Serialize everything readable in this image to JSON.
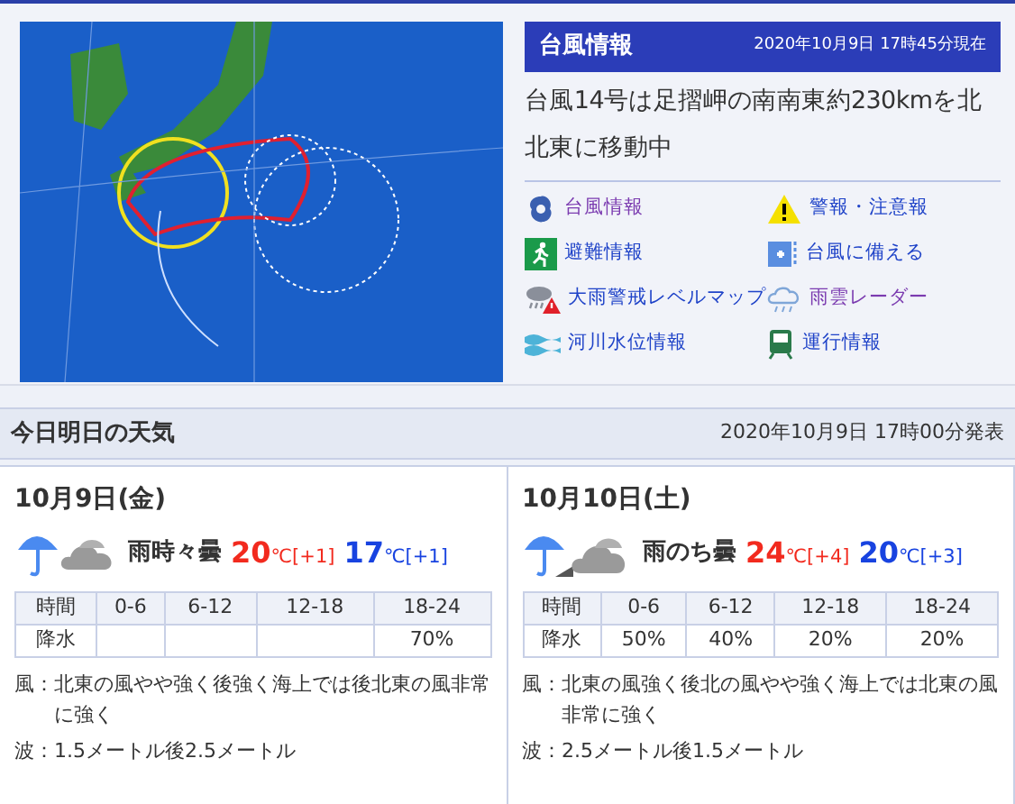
{
  "typhoon": {
    "title": "台風情報",
    "timestamp": "2020年10月9日 17時45分現在",
    "summary": "台風14号は足摺岬の南南東約230kmを北北東に移動中",
    "links": [
      {
        "kind": "typhoon",
        "label": "台風情報",
        "visited": true
      },
      {
        "kind": "warning",
        "label": "警報・注意報",
        "visited": false
      },
      {
        "kind": "evacuation",
        "label": "避難情報",
        "visited": false
      },
      {
        "kind": "prepare",
        "label": "台風に備える",
        "visited": false
      },
      {
        "kind": "heavy-rain",
        "label": "大雨警戒レベルマップ",
        "visited": false
      },
      {
        "kind": "radar",
        "label": "雨雲レーダー",
        "visited": true
      },
      {
        "kind": "river",
        "label": "河川水位情報",
        "visited": false
      },
      {
        "kind": "train",
        "label": "運行情報",
        "visited": false
      }
    ]
  },
  "forecast": {
    "title": "今日明日の天気",
    "issued": "2020年10月9日 17時00分発表",
    "days": [
      {
        "date": "10月9日(金)",
        "kind": "rain-sometimes-cloudy",
        "weather": "雨時々曇",
        "high": "20",
        "high_unit": "℃",
        "high_diff": "[+1]",
        "low": "17",
        "low_unit": "℃",
        "low_diff": "[+1]",
        "table": {
          "row_headers": [
            "時間",
            "降水"
          ],
          "columns": [
            {
              "time": "0-6"
            },
            {
              "time": "6-12"
            },
            {
              "time": "12-18"
            },
            {
              "time": "18-24",
              "precip": "70%"
            }
          ]
        },
        "wind_label": "風：",
        "wind": "北東の風やや強く後強く海上では後北東の風非常に強く",
        "wave_label": "波：",
        "wave": "1.5メートル後2.5メートル"
      },
      {
        "date": "10月10日(土)",
        "kind": "rain-then-cloudy",
        "weather": "雨のち曇",
        "high": "24",
        "high_unit": "℃",
        "high_diff": "[+4]",
        "low": "20",
        "low_unit": "℃",
        "low_diff": "[+3]",
        "table": {
          "row_headers": [
            "時間",
            "降水"
          ],
          "columns": [
            {
              "time": "0-6",
              "precip": "50%"
            },
            {
              "time": "6-12",
              "precip": "40%"
            },
            {
              "time": "12-18",
              "precip": "20%"
            },
            {
              "time": "18-24",
              "precip": "20%"
            }
          ]
        },
        "wind_label": "風：",
        "wind": "北東の風強く後北の風やや強く海上では北東の風非常に強く",
        "wave_label": "波：",
        "wave": "2.5メートル後1.5メートル"
      }
    ]
  }
}
